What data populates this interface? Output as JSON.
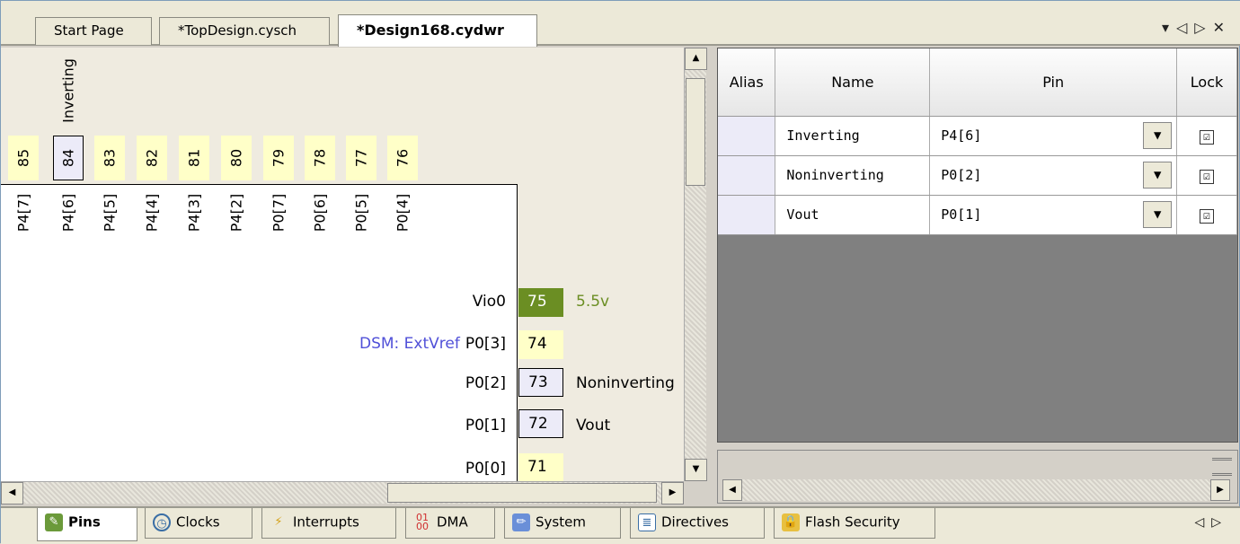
{
  "doc_tabs": [
    {
      "label": "Start Page",
      "active": false
    },
    {
      "label": "*TopDesign.cysch",
      "active": false
    },
    {
      "label": "*Design168.cydwr",
      "active": true
    }
  ],
  "window_controls": {
    "dropdown": "▾",
    "prev": "◁",
    "next": "▷",
    "close": "✕"
  },
  "diagram": {
    "vertical_label": "Inverting",
    "top_pins": [
      {
        "num": "85",
        "name": "P4[7]"
      },
      {
        "num": "84",
        "name": "P4[6]",
        "selected": true
      },
      {
        "num": "83",
        "name": "P4[5]"
      },
      {
        "num": "82",
        "name": "P4[4]"
      },
      {
        "num": "81",
        "name": "P4[3]"
      },
      {
        "num": "80",
        "name": "P4[2]"
      },
      {
        "num": "79",
        "name": "P0[7]"
      },
      {
        "num": "78",
        "name": "P0[6]"
      },
      {
        "num": "77",
        "name": "P0[5]"
      },
      {
        "num": "76",
        "name": "P0[4]"
      }
    ],
    "right_pins": [
      {
        "func": "",
        "name": "Vio0",
        "num": "75",
        "label": "5.5v",
        "style": "vio"
      },
      {
        "func": "DSM: ExtVref",
        "name": "P0[3]",
        "num": "74",
        "label": "",
        "style": "plain"
      },
      {
        "func": "",
        "name": "P0[2]",
        "num": "73",
        "label": "Noninverting",
        "style": "box"
      },
      {
        "func": "",
        "name": "P0[1]",
        "num": "72",
        "label": "Vout",
        "style": "box"
      },
      {
        "func": "",
        "name": "P0[0]",
        "num": "71",
        "label": "",
        "style": "plain"
      }
    ]
  },
  "table": {
    "headers": {
      "alias": "Alias",
      "name": "Name",
      "pin": "Pin",
      "lock": "Lock"
    },
    "rows": [
      {
        "alias": "",
        "name": "Inverting",
        "pin": "P4[6]",
        "lock": "☑"
      },
      {
        "alias": "",
        "name": "Noninverting",
        "pin": "P0[2]",
        "lock": "☑"
      },
      {
        "alias": "",
        "name": "Vout",
        "pin": "P0[1]",
        "lock": "☑"
      }
    ]
  },
  "bottom_tabs": [
    {
      "label": "Pins",
      "icon": "pins-icon",
      "active": true
    },
    {
      "label": "Clocks",
      "icon": "clock-icon",
      "active": false
    },
    {
      "label": "Interrupts",
      "icon": "lightning-icon",
      "active": false
    },
    {
      "label": "DMA",
      "icon": "dma-icon",
      "active": false
    },
    {
      "label": "System",
      "icon": "pencil-icon",
      "active": false
    },
    {
      "label": "Directives",
      "icon": "document-icon",
      "active": false
    },
    {
      "label": "Flash Security",
      "icon": "lock-icon",
      "active": false
    }
  ],
  "bottom_nav": {
    "prev": "◁",
    "next": "▷"
  }
}
